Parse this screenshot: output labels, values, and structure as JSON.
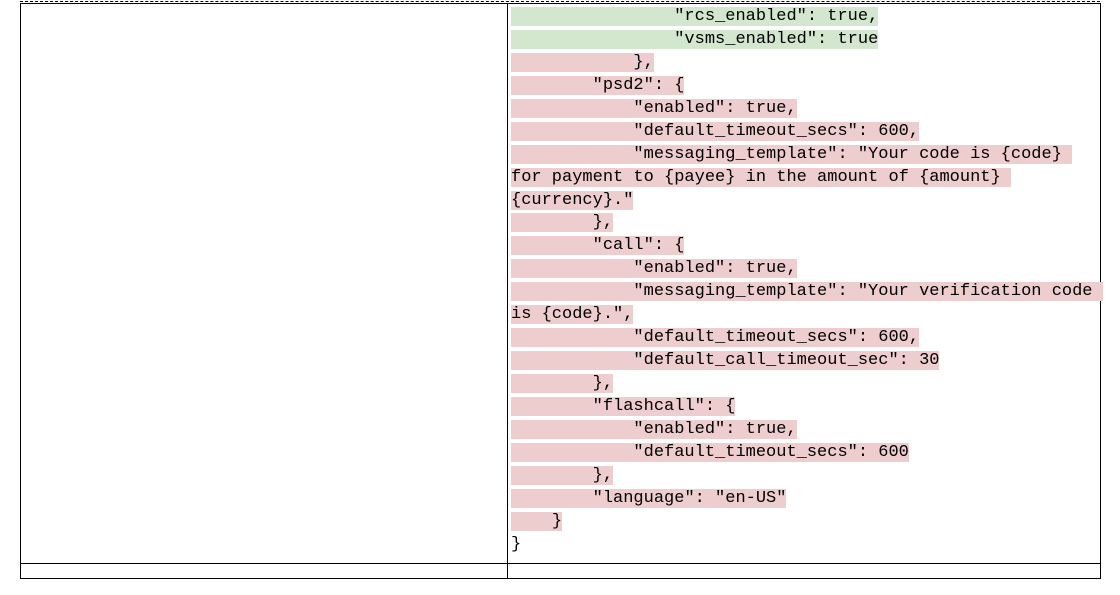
{
  "colors": {
    "add_bg": "#d2e7ce",
    "del_bg": "#eecdce"
  },
  "diff": {
    "lines": [
      {
        "style": "add",
        "indent": 16,
        "text": "\"rcs_enabled\": true,"
      },
      {
        "style": "add",
        "indent": 16,
        "text": "\"vsms_enabled\": true"
      },
      {
        "style": "del",
        "indent": 12,
        "text": "},"
      },
      {
        "style": "del",
        "indent": 8,
        "text": "\"psd2\": {"
      },
      {
        "style": "del",
        "indent": 12,
        "text": "\"enabled\": true,"
      },
      {
        "style": "del",
        "indent": 12,
        "text": "\"default_timeout_secs\": 600,"
      },
      {
        "style": "del",
        "indent": 12,
        "text": "\"messaging_template\": \"Your code is {code} for payment to {payee} in the amount of {amount} {currency}.\""
      },
      {
        "style": "del",
        "indent": 8,
        "text": "},"
      },
      {
        "style": "del",
        "indent": 8,
        "text": "\"call\": {"
      },
      {
        "style": "del",
        "indent": 12,
        "text": "\"enabled\": true,"
      },
      {
        "style": "del",
        "indent": 12,
        "text": "\"messaging_template\": \"Your verification code is {code}.\","
      },
      {
        "style": "del",
        "indent": 12,
        "text": "\"default_timeout_secs\": 600,"
      },
      {
        "style": "del",
        "indent": 12,
        "text": "\"default_call_timeout_sec\": 30"
      },
      {
        "style": "del",
        "indent": 8,
        "text": "},"
      },
      {
        "style": "del",
        "indent": 8,
        "text": "\"flashcall\": {"
      },
      {
        "style": "del",
        "indent": 12,
        "text": "\"enabled\": true,"
      },
      {
        "style": "del",
        "indent": 12,
        "text": "\"default_timeout_secs\": 600"
      },
      {
        "style": "del",
        "indent": 8,
        "text": "},"
      },
      {
        "style": "del",
        "indent": 8,
        "text": "\"language\": \"en-US\""
      },
      {
        "style": "del",
        "indent": 4,
        "text": "}"
      },
      {
        "style": "none",
        "indent": 0,
        "text": "}"
      }
    ]
  }
}
